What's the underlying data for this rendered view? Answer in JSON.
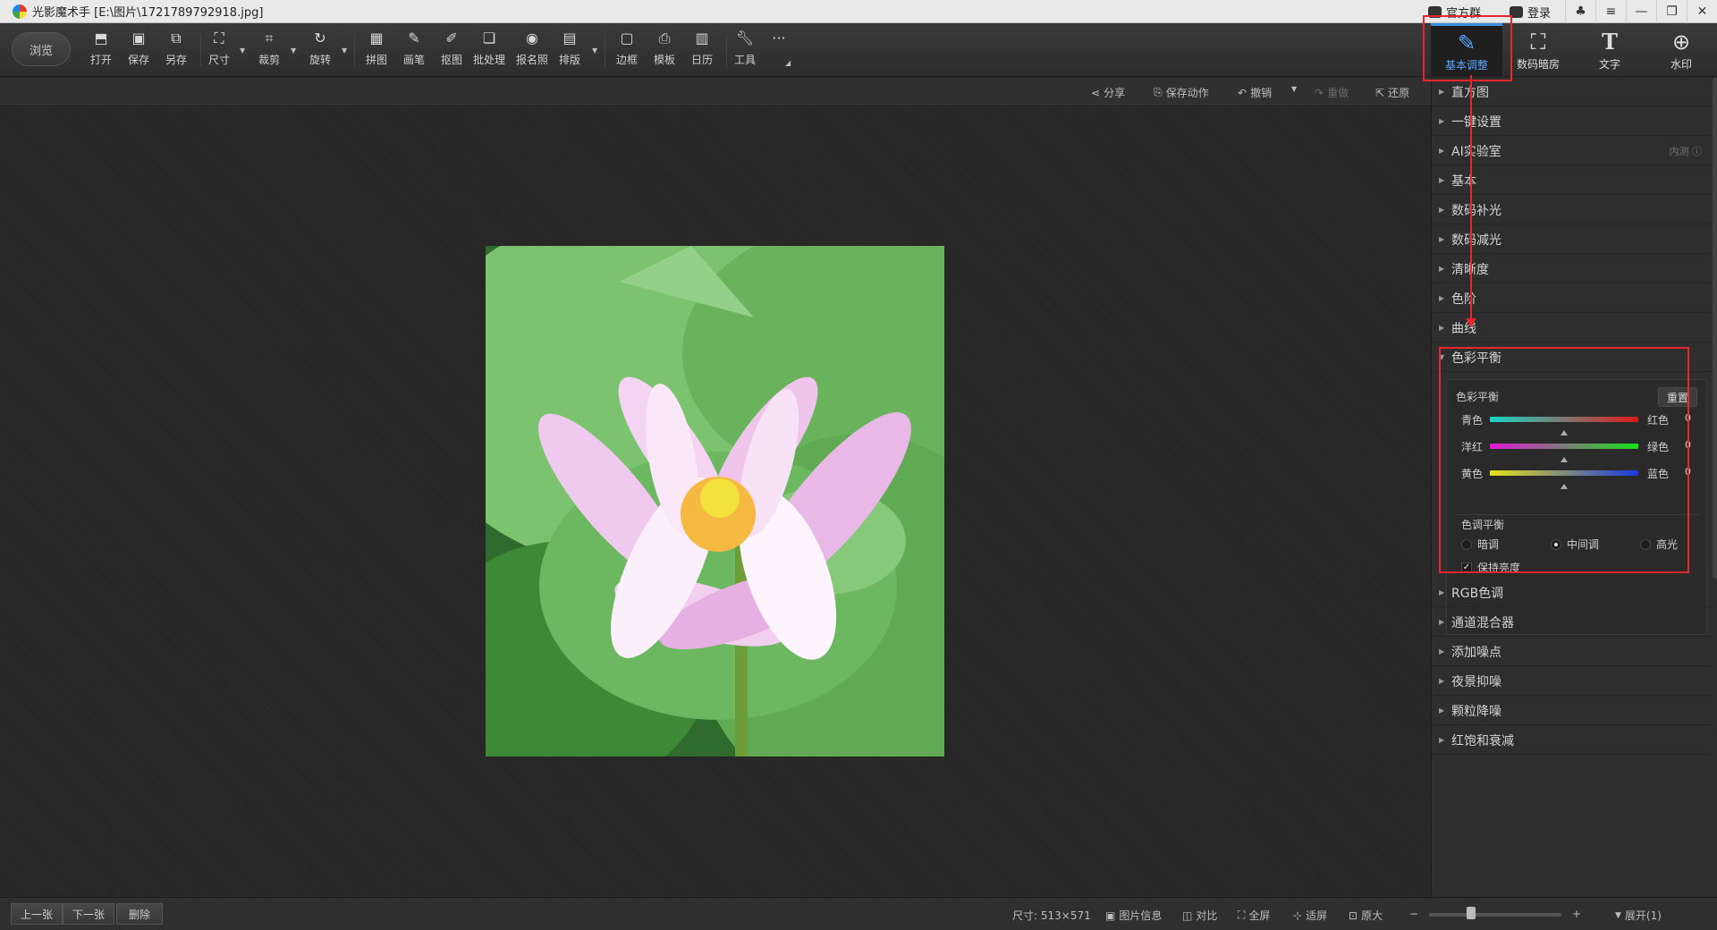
{
  "titlebar": {
    "title": "光影魔术手 [E:\\图片\\1721789792918.jpg]",
    "official_group": "官方群",
    "login": "登录"
  },
  "toolbar": {
    "browse": "浏览",
    "tools": [
      {
        "label": "打开",
        "icon": "open-icon"
      },
      {
        "label": "保存",
        "icon": "save-icon"
      },
      {
        "label": "另存",
        "icon": "save-as-icon"
      },
      {
        "label": "尺寸",
        "icon": "resize-icon"
      },
      {
        "label": "裁剪",
        "icon": "crop-icon"
      },
      {
        "label": "旋转",
        "icon": "rotate-icon"
      },
      {
        "label": "拼图",
        "icon": "collage-icon"
      },
      {
        "label": "画笔",
        "icon": "brush-icon"
      },
      {
        "label": "抠图",
        "icon": "cutout-icon"
      },
      {
        "label": "批处理",
        "icon": "batch-icon"
      },
      {
        "label": "报名照",
        "icon": "id-photo-icon"
      },
      {
        "label": "排版",
        "icon": "layout-icon"
      },
      {
        "label": "边框",
        "icon": "border-icon"
      },
      {
        "label": "模板",
        "icon": "template-icon"
      },
      {
        "label": "日历",
        "icon": "calendar-icon"
      },
      {
        "label": "工具",
        "icon": "wrench-icon"
      }
    ],
    "more": "···",
    "right_tabs": [
      {
        "label": "基本调整",
        "icon": "edit-icon",
        "active": true
      },
      {
        "label": "数码暗房",
        "icon": "camera-icon",
        "active": false
      },
      {
        "label": "文字",
        "icon": "text-icon",
        "active": false
      },
      {
        "label": "水印",
        "icon": "watermark-icon",
        "active": false
      }
    ]
  },
  "secondary": {
    "share": "分享",
    "save_action": "保存动作",
    "undo": "撤销",
    "redo": "重做",
    "restore": "还原"
  },
  "panel": {
    "items_top": [
      {
        "label": "直方图"
      },
      {
        "label": "一键设置"
      },
      {
        "label": "AI实验室",
        "extra": "内测 ⓘ"
      },
      {
        "label": "基本"
      },
      {
        "label": "数码补光"
      },
      {
        "label": "数码减光"
      },
      {
        "label": "清晰度"
      },
      {
        "label": "色阶"
      },
      {
        "label": "曲线"
      }
    ],
    "expanded": {
      "label": "色彩平衡",
      "group_title": "色彩平衡",
      "reset": "重置",
      "sliders": [
        {
          "left": "青色",
          "right": "红色",
          "value": "0",
          "colors": [
            "#18d6c8",
            "#e11919"
          ]
        },
        {
          "left": "洋红",
          "right": "绿色",
          "value": "0",
          "colors": [
            "#e018d6",
            "#19e119"
          ]
        },
        {
          "left": "黄色",
          "right": "蓝色",
          "value": "0",
          "colors": [
            "#e8e018",
            "#1939e1"
          ]
        }
      ],
      "tone_title": "色调平衡",
      "tones": [
        {
          "label": "暗调",
          "checked": false
        },
        {
          "label": "中间调",
          "checked": true
        },
        {
          "label": "高光",
          "checked": false
        }
      ],
      "keep_brightness": "保持亮度"
    },
    "items_bottom": [
      {
        "label": "RGB色调"
      },
      {
        "label": "通道混合器"
      },
      {
        "label": "添加噪点"
      },
      {
        "label": "夜景抑噪"
      },
      {
        "label": "颗粒降噪"
      },
      {
        "label": "红饱和衰减"
      }
    ]
  },
  "statusbar": {
    "prev": "上一张",
    "next": "下一张",
    "delete": "删除",
    "size": "尺寸: 513×571",
    "info": "图片信息",
    "compare": "对比",
    "fullscreen": "全屏",
    "fit": "适屏",
    "original": "原大",
    "minus": "−",
    "plus": "+",
    "expand": "展开(1)"
  }
}
